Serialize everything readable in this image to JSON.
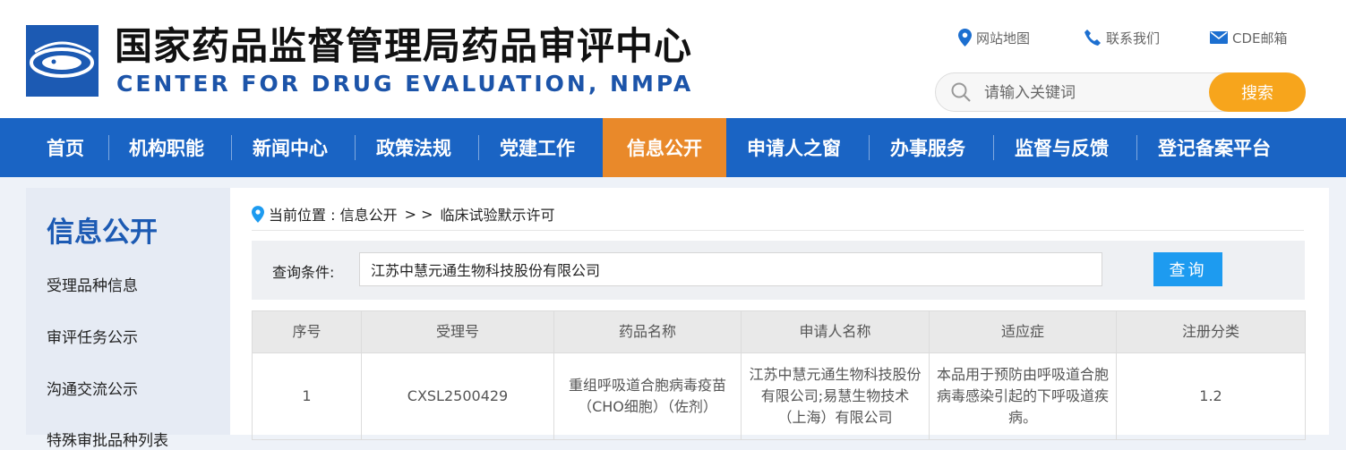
{
  "site": {
    "title_cn": "国家药品监督管理局药品审评中心",
    "title_en": "CENTER FOR DRUG EVALUATION, NMPA"
  },
  "toplinks": {
    "sitemap": "网站地图",
    "contact": "联系我们",
    "mail": "CDE邮箱"
  },
  "search": {
    "placeholder": "请输入关键词",
    "button": "搜索"
  },
  "nav": {
    "items": [
      "首页",
      "机构职能",
      "新闻中心",
      "政策法规",
      "党建工作",
      "信息公开",
      "申请人之窗",
      "办事服务",
      "监督与反馈",
      "登记备案平台"
    ],
    "active_index": 5
  },
  "sidebar": {
    "title": "信息公开",
    "items": [
      "受理品种信息",
      "审评任务公示",
      "沟通交流公示",
      "特殊审批品种列表"
    ]
  },
  "breadcrumb": {
    "label": "当前位置 : 信息公开",
    "sep": "> >",
    "current": "临床试验默示许可"
  },
  "query": {
    "label": "查询条件:",
    "value": "江苏中慧元通生物科技股份有限公司",
    "button": "查询"
  },
  "table": {
    "headers": [
      "序号",
      "受理号",
      "药品名称",
      "申请人名称",
      "适应症",
      "注册分类"
    ],
    "rows": [
      [
        "1",
        "CXSL2500429",
        "重组呼吸道合胞病毒疫苗（CHO细胞）（佐剂）",
        "江苏中慧元通生物科技股份有限公司;易慧生物技术（上海）有限公司",
        "本品用于预防由呼吸道合胞病毒感染引起的下呼吸道疾病。",
        "1.2"
      ]
    ]
  },
  "colors": {
    "brand_blue": "#1c5ab3",
    "nav_blue": "#1a64c4",
    "nav_active": "#e9892a",
    "search_button": "#f7a51c",
    "query_button": "#1d9bf0"
  }
}
